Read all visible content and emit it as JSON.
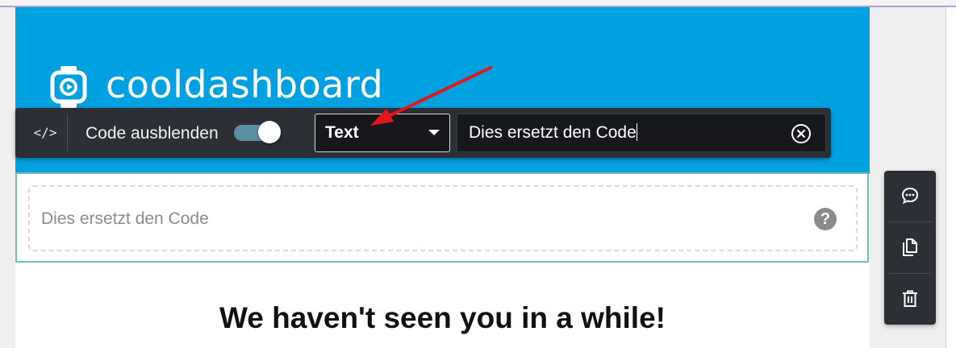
{
  "brand": {
    "name": "cooldashboard",
    "logo_icon": "smartwatch-icon"
  },
  "toolbar": {
    "code_toggle_glyph": "</>",
    "hide_code_label": "Code ausblenden",
    "hide_code_enabled": true,
    "type_select": {
      "value": "Text"
    },
    "replacement_input": {
      "value": "Dies ersetzt den Code"
    }
  },
  "code_block": {
    "placeholder": "Dies ersetzt den Code",
    "help_glyph": "?"
  },
  "email": {
    "headline": "We haven't seen you in a while!"
  },
  "side_actions": [
    {
      "name": "comment",
      "icon": "comment-icon"
    },
    {
      "name": "duplicate",
      "icon": "copy-icon"
    },
    {
      "name": "delete",
      "icon": "trash-icon"
    }
  ],
  "colors": {
    "hero": "#00a1e0",
    "toolbar": "#2c2f35",
    "selected_outline": "#72c3ad",
    "annotation_arrow": "#e8141b"
  }
}
